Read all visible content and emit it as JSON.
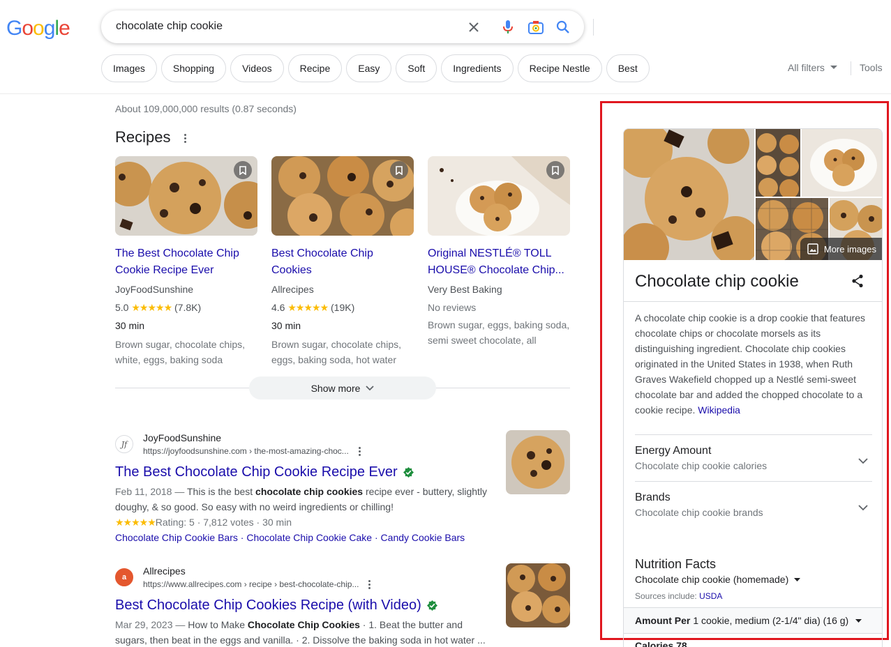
{
  "header": {
    "logo_letters": [
      "G",
      "o",
      "o",
      "g",
      "l",
      "e"
    ],
    "logo_colors": [
      "#4285f4",
      "#ea4335",
      "#fbbc05",
      "#4285f4",
      "#34a853",
      "#ea4335"
    ],
    "search_query": "chocolate chip cookie",
    "chips": [
      "Images",
      "Shopping",
      "Videos",
      "Recipe",
      "Easy",
      "Soft",
      "Ingredients",
      "Recipe Nestle",
      "Best"
    ],
    "all_filters": "All filters",
    "tools": "Tools"
  },
  "stats": "About 109,000,000 results (0.87 seconds)",
  "recipes": {
    "title": "Recipes",
    "cards": [
      {
        "title": "The Best Chocolate Chip Cookie Recipe Ever",
        "source": "JoyFoodSunshine",
        "rating": "5.0",
        "stars": "★★★★★",
        "votes": "(7.8K)",
        "time": "30 min",
        "ingredients": "Brown sugar, chocolate chips, white, eggs, baking soda"
      },
      {
        "title": "Best Chocolate Chip Cookies",
        "source": "Allrecipes",
        "rating": "4.6",
        "stars": "★★★★★",
        "votes": "(19K)",
        "time": "30 min",
        "ingredients": "Brown sugar, chocolate chips, eggs, baking soda, hot water"
      },
      {
        "title": "Original NESTLÉ® TOLL HOUSE® Chocolate Chip...",
        "source": "Very Best Baking",
        "no_reviews": "No reviews",
        "ingredients": "Brown sugar, eggs, baking soda, semi sweet chocolate, all"
      }
    ],
    "show_more": "Show more"
  },
  "results": [
    {
      "site": "JoyFoodSunshine",
      "url": "https://joyfoodsunshine.com › the-most-amazing-choc...",
      "title": "The Best Chocolate Chip Cookie Recipe Ever",
      "date": "Feb 11, 2018 — ",
      "snippet_pre": "This is the best ",
      "snippet_bold": "chocolate chip cookies",
      "snippet_post": " recipe ever - buttery, slightly doughy, & so good. So easy with no weird ingredients or chilling!",
      "stars": "★★★★★",
      "meta": "Rating: 5 · 7,812 votes · 30 min",
      "links": [
        "Chocolate Chip Cookie Bars",
        "Chocolate Chip Cookie Cake",
        "Candy Cookie Bars"
      ]
    },
    {
      "site": "Allrecipes",
      "url": "https://www.allrecipes.com › recipe › best-chocolate-chip...",
      "title": "Best Chocolate Chip Cookies Recipe (with Video)",
      "date": "Mar 29, 2023 — ",
      "snippet_pre": "How to Make ",
      "snippet_bold": "Chocolate Chip Cookies",
      "snippet_post": " · 1. Beat the butter and sugars, then beat in the eggs and vanilla. · 2. Dissolve the baking soda in hot water ..."
    }
  ],
  "knowledge_panel": {
    "more_images": "More images",
    "title": "Chocolate chip cookie",
    "description": "A chocolate chip cookie is a drop cookie that features chocolate chips or chocolate morsels as its distinguishing ingredient. Chocolate chip cookies originated in the United States in 1938, when Ruth Graves Wakefield chopped up a Nestlé semi-sweet chocolate bar and added the chopped chocolate to a cookie recipe. ",
    "wiki_link": "Wikipedia",
    "rows": [
      {
        "title": "Energy Amount",
        "subtitle": "Chocolate chip cookie calories"
      },
      {
        "title": "Brands",
        "subtitle": "Chocolate chip cookie brands"
      }
    ],
    "nutrition": {
      "title": "Nutrition Facts",
      "subtitle": "Chocolate chip cookie (homemade)",
      "sources_label": "Sources include: ",
      "sources_link": "USDA",
      "amount_label": "Amount Per",
      "amount_value": "1 cookie, medium (2-1/4\" dia) (16 g)",
      "calories": "Calories 78"
    }
  },
  "colors": {
    "link": "#1a0dab",
    "highlight": "#e0171f",
    "star": "#fbbc04",
    "verified": "#1e8e3e"
  }
}
